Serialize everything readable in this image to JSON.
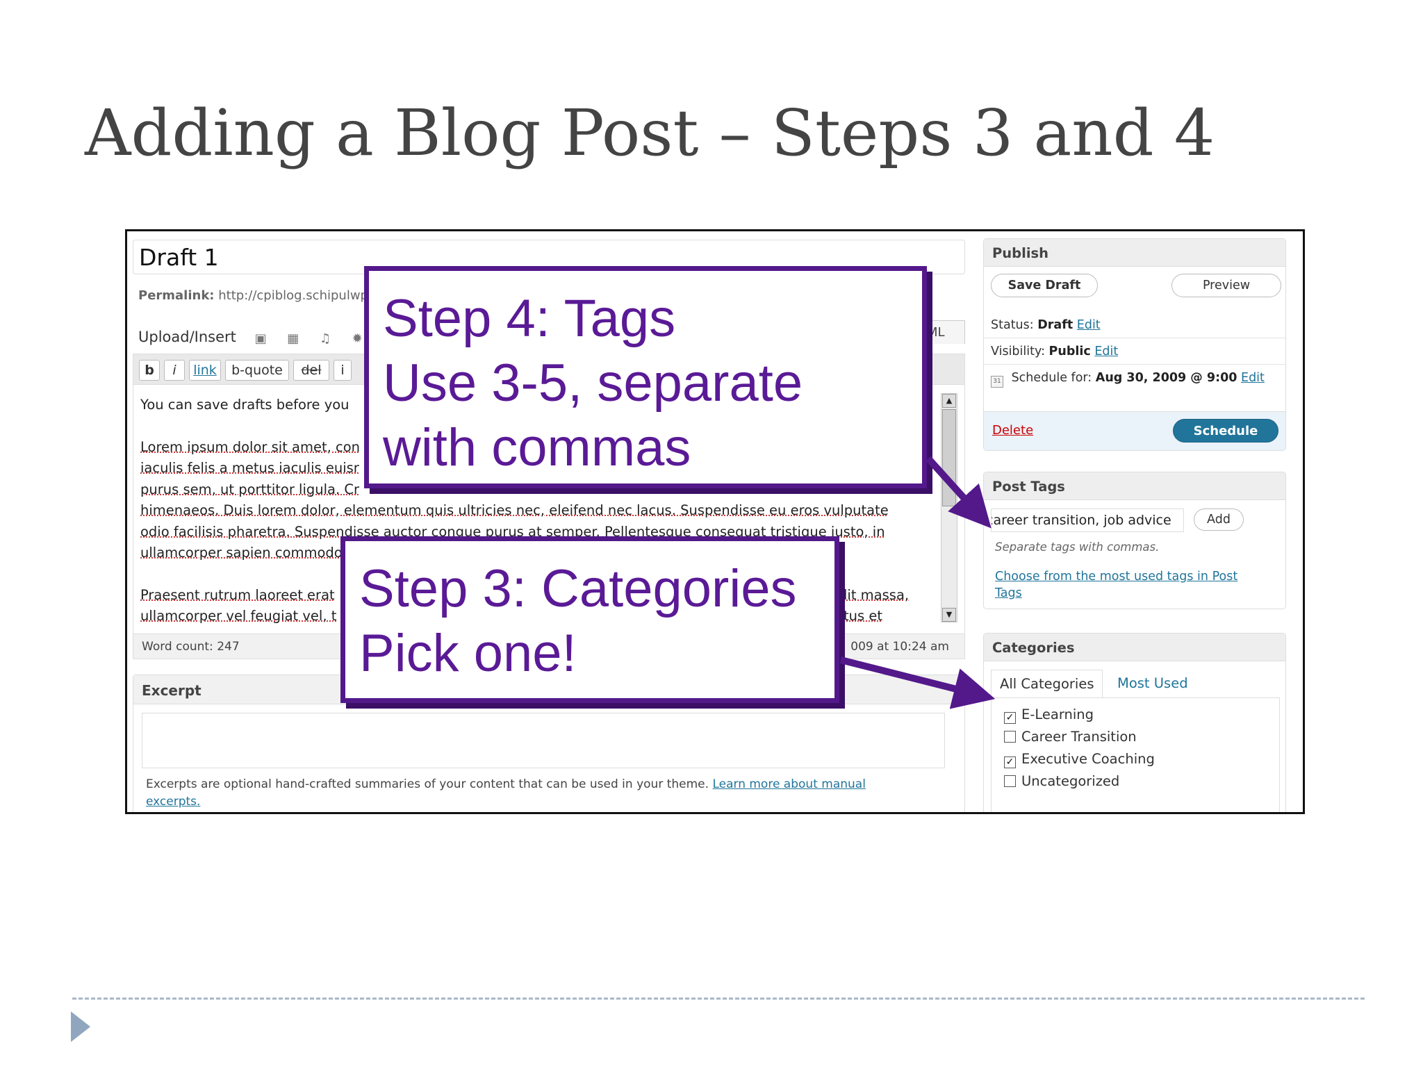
{
  "slide": {
    "title": "Adding a Blog Post – Steps 3 and 4"
  },
  "editor": {
    "post_title": "Draft 1",
    "permalink_label": "Permalink:",
    "permalink_url": "http://cpiblog.schipulwp",
    "upload_insert_label": "Upload/Insert",
    "html_tab_fragment": "ML",
    "toolbar": {
      "bold": "b",
      "italic": "i",
      "link": "link",
      "bquote": "b-quote",
      "del": "del",
      "ins_fragment": "i"
    },
    "content": {
      "line1": "You can save drafts before you",
      "p2": [
        "Lorem ipsum dolor sit amet, con",
        "iaculis felis a metus iaculis euisr",
        "purus sem, ut porttitor ligula. Cr",
        "himenaeos. Duis lorem dolor, elementum quis ultricies nec, eleifend nec lacus. Suspendisse eu eros vulputate",
        "odio facilisis pharetra. Suspendisse auctor congue purus at semper. Pellentesque consequat tristique justo, in",
        "ullamcorper sapien commodo"
      ],
      "p3": [
        "Praesent rutrum laoreet erat",
        "ullamcorper vel feugiat vel, t"
      ],
      "p3_right": [
        "lit massa,",
        "tus et"
      ]
    },
    "word_count": "Word count: 247",
    "last_saved_fragment": "009 at 10:24 am"
  },
  "excerpt": {
    "heading": "Excerpt",
    "help_text": "Excerpts are optional hand-crafted summaries of your content that can be used in your theme.",
    "help_link": "Learn more about manual excerpts."
  },
  "publish": {
    "heading": "Publish",
    "save_draft": "Save Draft",
    "preview": "Preview",
    "status_label": "Status:",
    "status_value": "Draft",
    "visibility_label": "Visibility:",
    "visibility_value": "Public",
    "schedule_label": "Schedule for:",
    "schedule_value": "Aug 30, 2009 @ 9:00",
    "edit": "Edit",
    "delete": "Delete",
    "schedule_button": "Schedule"
  },
  "post_tags": {
    "heading": "Post Tags",
    "input_value": "career transition, job advice",
    "add_button": "Add",
    "help": "Separate tags with commas.",
    "choose_link": "Choose from the most used tags in Post Tags"
  },
  "categories": {
    "heading": "Categories",
    "tab_all": "All Categories",
    "tab_most_used": "Most Used",
    "items": [
      {
        "label": "E-Learning",
        "checked": true
      },
      {
        "label": "Career Transition",
        "checked": false
      },
      {
        "label": "Executive Coaching",
        "checked": true
      },
      {
        "label": "Uncategorized",
        "checked": false
      }
    ]
  },
  "callouts": {
    "step4": [
      "Step 4: Tags",
      "Use 3-5, separate",
      "with commas"
    ],
    "step3": [
      "Step 3: Categories",
      "Pick one!"
    ]
  },
  "colors": {
    "callout_border": "#53198b",
    "callout_text": "#5a1a96",
    "link": "#21759b",
    "schedule_button": "#21759b",
    "delete": "#cc0000"
  }
}
